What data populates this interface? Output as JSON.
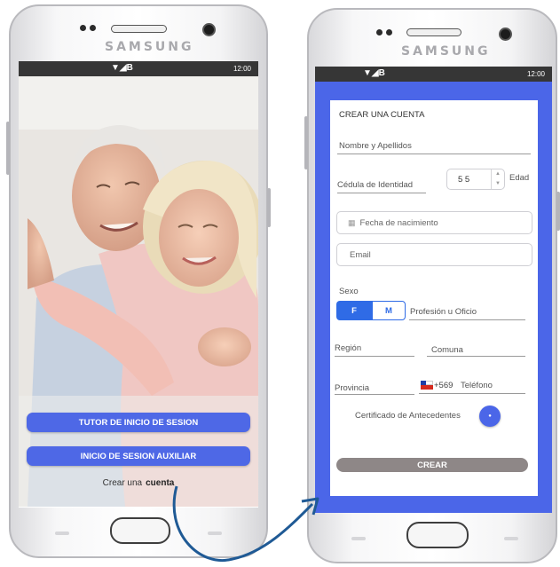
{
  "status": {
    "time": "12:00",
    "signal_text": "▼◢B"
  },
  "brand": "SAMSUNG",
  "login": {
    "tutor_button": "TUTOR DE INICIO DE SESION",
    "aux_button": "INICIO DE SESION AUXILIAR",
    "create_prefix": "Crear una",
    "create_link": "cuenta"
  },
  "register": {
    "title": "CREAR UNA CUENTA",
    "name_placeholder": "Nombre y Apellidos",
    "id_placeholder": "Cédula de Identidad",
    "age_value": "5 5",
    "age_label": "Edad",
    "birth_placeholder": "Fecha de nacimiento",
    "email_placeholder": "Email",
    "sex_label": "Sexo",
    "sex_f": "F",
    "sex_m": "M",
    "profession_placeholder": "Profesión u Oficio",
    "region_placeholder": "Región",
    "comuna_placeholder": "Comuna",
    "provincia_placeholder": "Provincia",
    "phone_prefix": "+569",
    "phone_placeholder": "Teléfono",
    "cert_label": "Certificado de Antecedentes",
    "submit": "CREAR"
  },
  "colors": {
    "primary": "#4b66e8",
    "status": "#363636",
    "submit": "#8e8787"
  }
}
